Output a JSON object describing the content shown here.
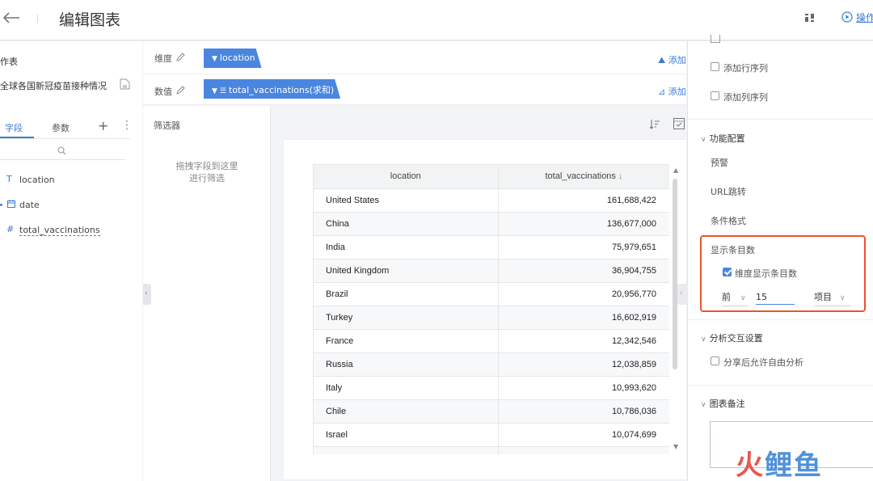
{
  "header": {
    "title": "编辑图表",
    "operation_label": "操作"
  },
  "left_panel": {
    "worktable_label": "作表",
    "dataset_name": "全球各国新冠疫苗接种情况",
    "tabs": [
      {
        "label": "字段",
        "active": true
      },
      {
        "label": "参数",
        "active": false
      }
    ],
    "fields": [
      {
        "type_icon": "T",
        "name": "location"
      },
      {
        "type_icon": "date-icon",
        "name": "date"
      },
      {
        "type_icon": "#",
        "name": "total_vaccinations"
      }
    ]
  },
  "dimension_row": {
    "label": "维度",
    "pill": "location",
    "add_label": "添加"
  },
  "value_row": {
    "label": "数值",
    "pill": "total_vaccinations(求和)",
    "add_label": "添加"
  },
  "filter": {
    "title": "筛选器",
    "hint_line1": "拖拽字段到这里",
    "hint_line2": "进行筛选"
  },
  "table": {
    "columns": [
      "location",
      "total_vaccinations"
    ],
    "rows": [
      [
        "United States",
        "161,688,422"
      ],
      [
        "China",
        "136,677,000"
      ],
      [
        "India",
        "75,979,651"
      ],
      [
        "United Kingdom",
        "36,904,755"
      ],
      [
        "Brazil",
        "20,956,770"
      ],
      [
        "Turkey",
        "16,602,919"
      ],
      [
        "France",
        "12,342,546"
      ],
      [
        "Russia",
        "12,038,859"
      ],
      [
        "Italy",
        "10,993,620"
      ],
      [
        "Chile",
        "10,786,036"
      ],
      [
        "Israel",
        "10,074,699"
      ],
      [
        "",
        ""
      ]
    ]
  },
  "right_panel": {
    "add_row_seq": "添加行序列",
    "add_col_seq": "添加列序列",
    "function_config": "功能配置",
    "alert": "预警",
    "url_jump": "URL跳转",
    "conditional_format": "条件格式",
    "show_count_title": "显示条目数",
    "dimension_show_count": "维度显示条目数",
    "dimension_show_count_checked": true,
    "top_select": "前",
    "count_value": "15",
    "unit_select": "项目",
    "analysis_settings": "分析交互设置",
    "allow_free_analysis": "分享后允许自由分析",
    "chart_notes": "图表备注"
  },
  "colors": {
    "accent": "#4a86e0",
    "highlight": "#e8552f"
  },
  "watermark": {
    "text_red": "火",
    "text_blue": "鲤鱼"
  }
}
